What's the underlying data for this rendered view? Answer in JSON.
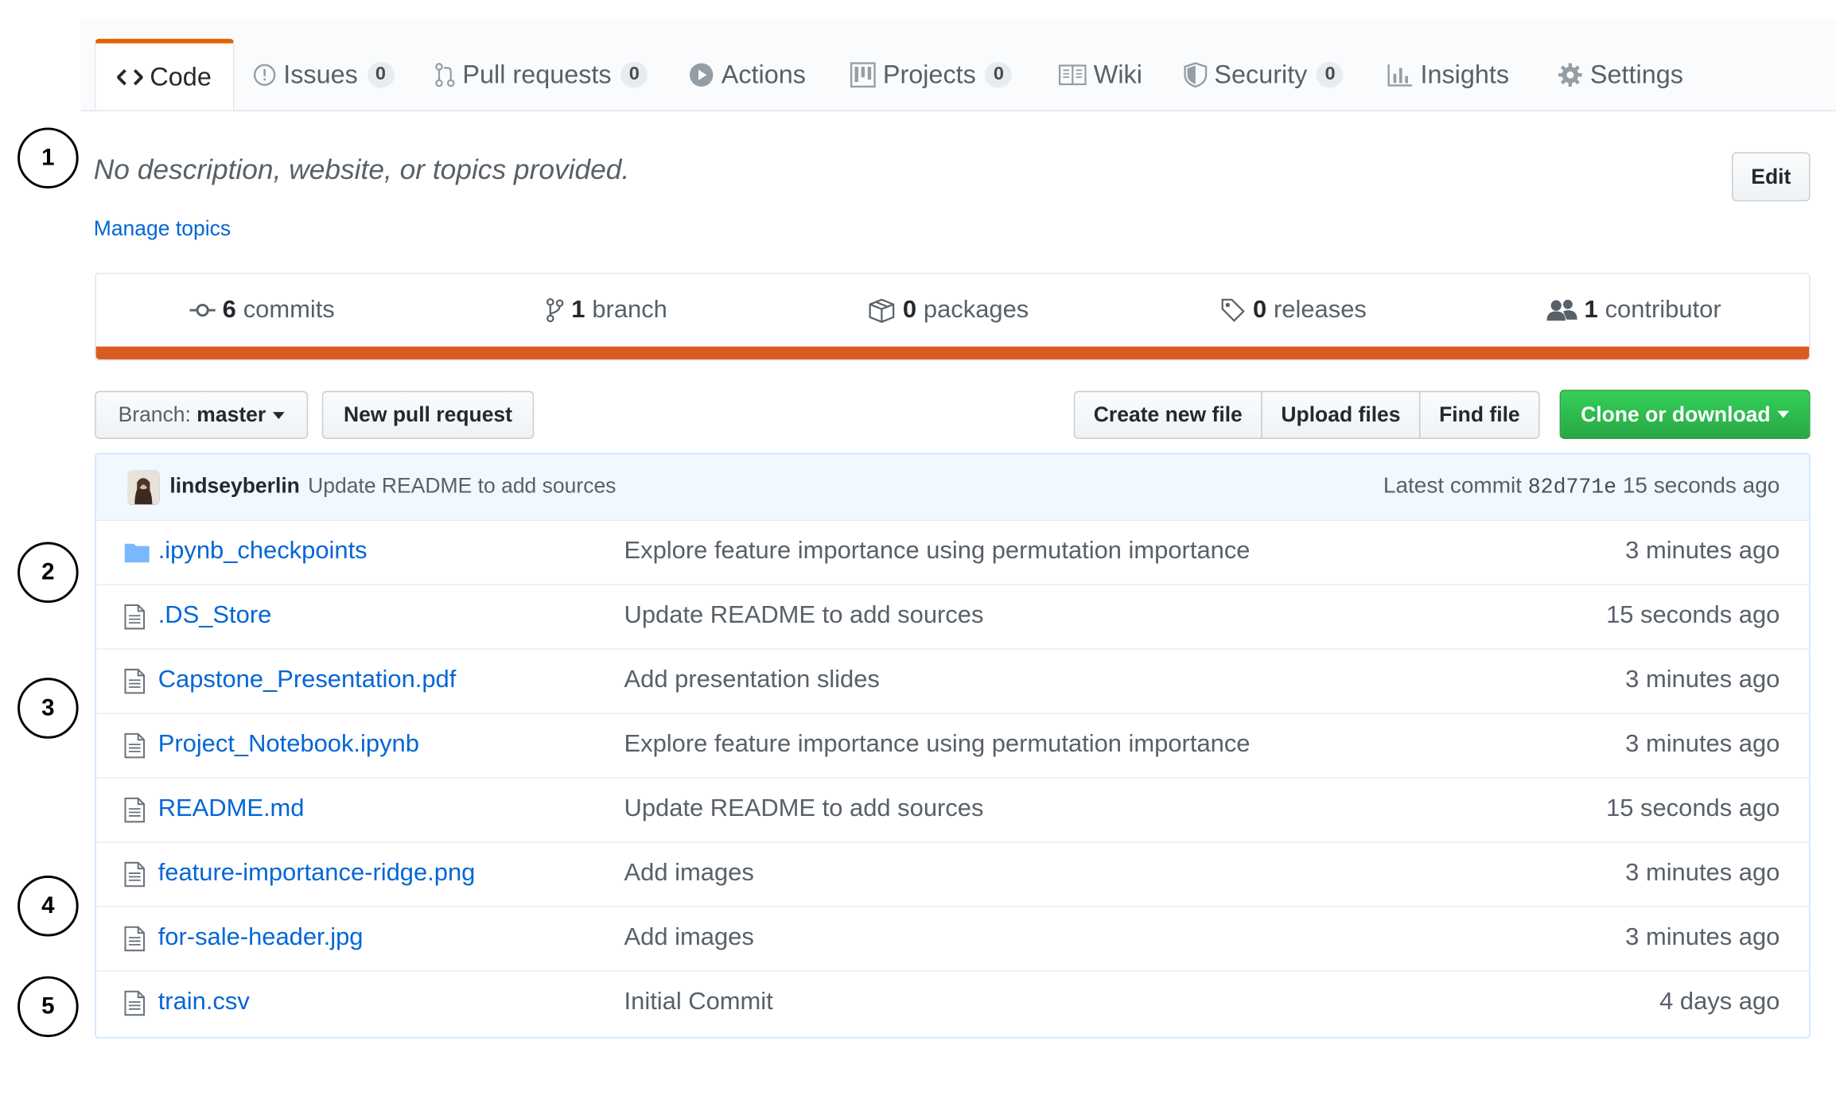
{
  "tabs": [
    {
      "label": "Code",
      "icon": "code-icon",
      "selected": true
    },
    {
      "label": "Issues",
      "icon": "issue-icon",
      "count": "0"
    },
    {
      "label": "Pull requests",
      "icon": "pull-request-icon",
      "count": "0"
    },
    {
      "label": "Actions",
      "icon": "play-icon"
    },
    {
      "label": "Projects",
      "icon": "project-icon",
      "count": "0"
    },
    {
      "label": "Wiki",
      "icon": "book-icon"
    },
    {
      "label": "Security",
      "icon": "shield-icon",
      "count": "0"
    },
    {
      "label": "Insights",
      "icon": "graph-icon"
    },
    {
      "label": "Settings",
      "icon": "gear-icon"
    }
  ],
  "callouts": [
    "1",
    "2",
    "3",
    "4",
    "5"
  ],
  "repo": {
    "description": "No description, website, or topics provided.",
    "manage_topics": "Manage topics",
    "edit_label": "Edit"
  },
  "summary": {
    "commits": {
      "count": "6",
      "label": "commits"
    },
    "branches": {
      "count": "1",
      "label": "branch"
    },
    "packages": {
      "count": "0",
      "label": "packages"
    },
    "releases": {
      "count": "0",
      "label": "releases"
    },
    "contributors": {
      "count": "1",
      "label": "contributor"
    },
    "language_bar_color": "#da5b23"
  },
  "toolbar": {
    "branch_prefix": "Branch:",
    "branch_name": "master",
    "new_pull_request": "New pull request",
    "create_new_file": "Create new file",
    "upload_files": "Upload files",
    "find_file": "Find file",
    "clone_or_download": "Clone or download"
  },
  "commit": {
    "author": "lindseyberlin",
    "message": "Update README to add sources",
    "latest_label": "Latest commit",
    "sha": "82d771e",
    "age": "15 seconds ago"
  },
  "files": [
    {
      "name": ".ipynb_checkpoints",
      "type": "folder",
      "message": "Explore feature importance using permutation importance",
      "age": "3 minutes ago"
    },
    {
      "name": ".DS_Store",
      "type": "file",
      "message": "Update README to add sources",
      "age": "15 seconds ago"
    },
    {
      "name": "Capstone_Presentation.pdf",
      "type": "file",
      "message": "Add presentation slides",
      "age": "3 minutes ago"
    },
    {
      "name": "Project_Notebook.ipynb",
      "type": "file",
      "message": "Explore feature importance using permutation importance",
      "age": "3 minutes ago"
    },
    {
      "name": "README.md",
      "type": "file",
      "message": "Update README to add sources",
      "age": "15 seconds ago"
    },
    {
      "name": "feature-importance-ridge.png",
      "type": "file",
      "message": "Add images",
      "age": "3 minutes ago"
    },
    {
      "name": "for-sale-header.jpg",
      "type": "file",
      "message": "Add images",
      "age": "3 minutes ago"
    },
    {
      "name": "train.csv",
      "type": "file",
      "message": "Initial Commit",
      "age": "4 days ago"
    }
  ]
}
